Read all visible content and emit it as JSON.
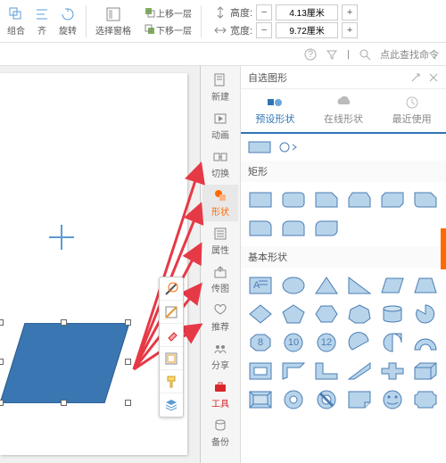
{
  "ribbon": {
    "group": "组合",
    "align": "齐",
    "rotate": "旋转",
    "select_pane": "选择窗格",
    "up_layer": "上移一层",
    "down_layer": "下移一层",
    "height_label": "高度:",
    "height_value": "4.13厘米",
    "width_label": "宽度:",
    "width_value": "9.72厘米"
  },
  "search": {
    "placeholder": "点此查找命令"
  },
  "sidebar": {
    "items": [
      {
        "label": "新建"
      },
      {
        "label": "动画"
      },
      {
        "label": "切换"
      },
      {
        "label": "形状"
      },
      {
        "label": "属性"
      },
      {
        "label": "传图"
      },
      {
        "label": "推荐"
      },
      {
        "label": "分享"
      },
      {
        "label": "工具"
      },
      {
        "label": "备份"
      }
    ]
  },
  "panel": {
    "title": "自选图形",
    "tabs": [
      {
        "label": "预设形状"
      },
      {
        "label": "在线形状"
      },
      {
        "label": "最近使用"
      }
    ],
    "section_rect": "矩形",
    "section_basic": "基本形状"
  }
}
